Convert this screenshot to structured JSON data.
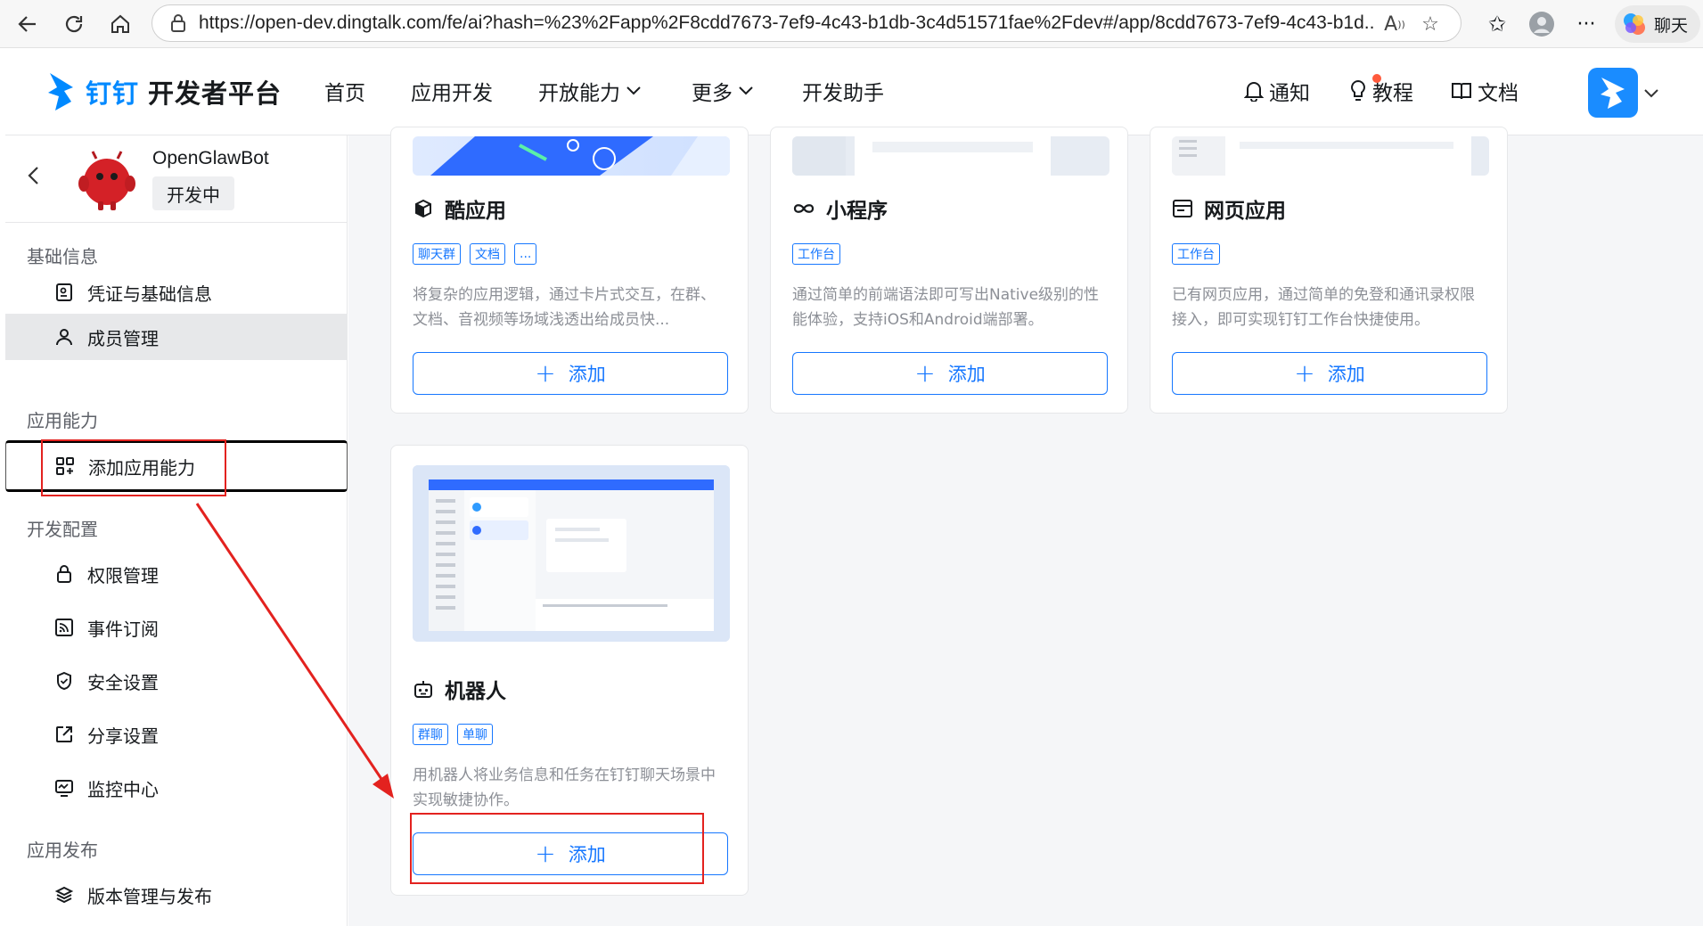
{
  "browser": {
    "url": "https://open-dev.dingtalk.com/fe/ai?hash=%23%2Fapp%2F8cdd7673-7ef9-4c43-b1db-3c4d51571fae%2Fdev#/app/8cdd7673-7ef9-4c43-b1d...",
    "chat_label": "聊天"
  },
  "header": {
    "brand_prefix": "钉钉",
    "brand_suffix": "开发者平台",
    "nav": [
      "首页",
      "应用开发",
      "开放能力",
      "更多",
      "开发助手"
    ],
    "notify": "通知",
    "tutorial": "教程",
    "docs": "文档"
  },
  "sidebar": {
    "app_name": "OpenGlawBot",
    "app_status": "开发中",
    "sections": {
      "basic": "基础信息",
      "capability": "应用能力",
      "dev_config": "开发配置",
      "publish": "应用发布"
    },
    "items": {
      "credentials": "凭证与基础信息",
      "members": "成员管理",
      "add_capability": "添加应用能力",
      "permissions": "权限管理",
      "events": "事件订阅",
      "security": "安全设置",
      "share": "分享设置",
      "monitor": "监控中心",
      "version": "版本管理与发布"
    }
  },
  "cards": [
    {
      "title": "酷应用",
      "tags": [
        "聊天群",
        "文档",
        "..."
      ],
      "desc": "将复杂的应用逻辑，通过卡片式交互，在群、文档、音视频等场域浅透出给成员快...",
      "button": "添加"
    },
    {
      "title": "小程序",
      "tags": [
        "工作台"
      ],
      "desc": "通过简单的前端语法即可写出Native级别的性能体验，支持iOS和Android端部署。",
      "button": "添加"
    },
    {
      "title": "网页应用",
      "tags": [
        "工作台"
      ],
      "desc": "已有网页应用，通过简单的免登和通讯录权限接入，即可实现钉钉工作台快捷使用。",
      "button": "添加"
    },
    {
      "title": "机器人",
      "tags": [
        "群聊",
        "单聊"
      ],
      "desc": "用机器人将业务信息和任务在钉钉聊天场景中实现敏捷协作。",
      "button": "添加"
    }
  ],
  "colors": {
    "accent": "#1677ff",
    "annotation": "#e3221f",
    "brand_blue": "#0089ff"
  }
}
